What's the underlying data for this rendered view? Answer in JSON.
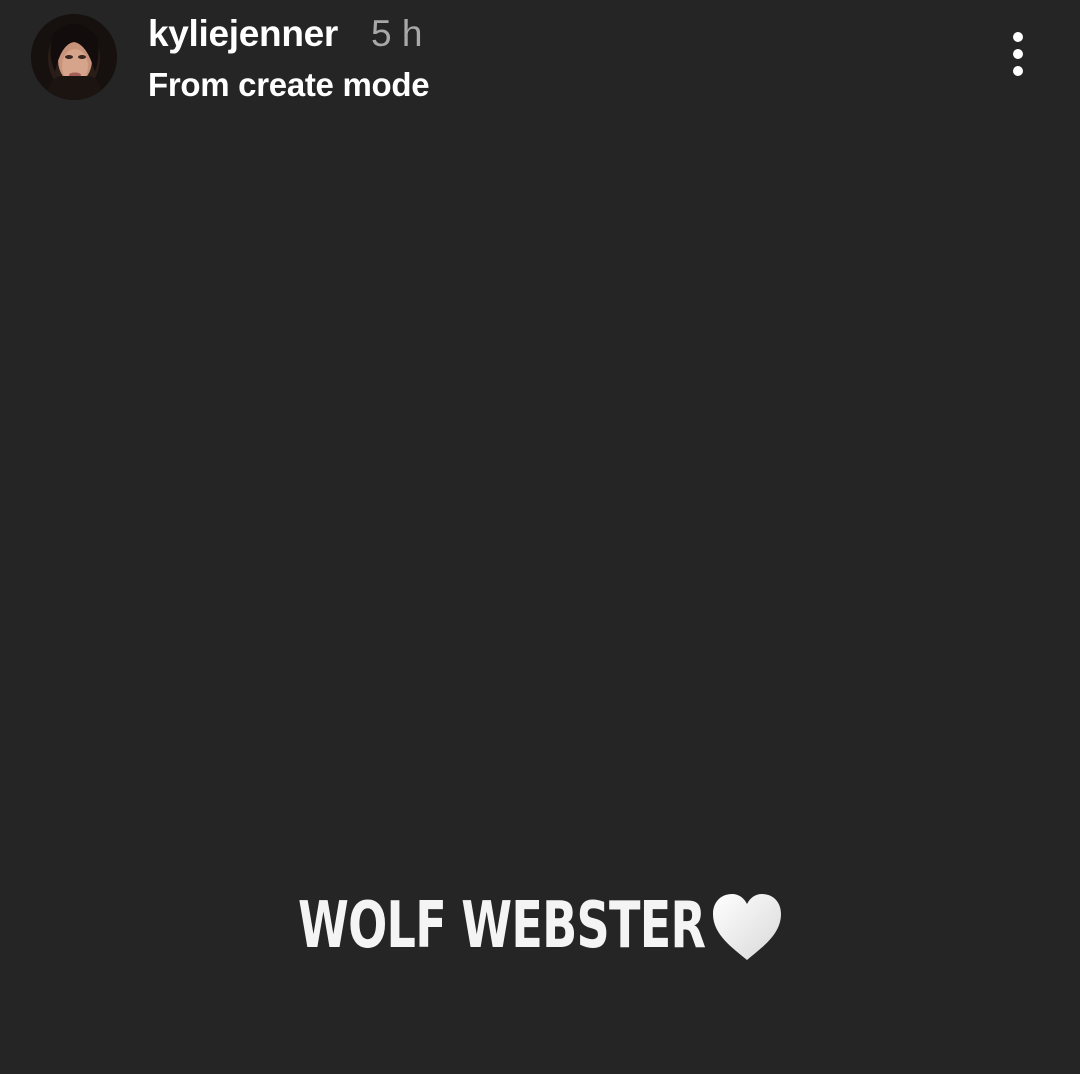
{
  "story_header": {
    "username": "kyliejenner",
    "timestamp": "5 h",
    "subtitle": "From create mode",
    "avatar_icon": "profile-photo",
    "more_icon": "vertical-ellipsis-icon"
  },
  "story_content": {
    "caption": "WOLF WEBSTER",
    "emoji": "white-heart-icon",
    "background_color": "#252525"
  }
}
